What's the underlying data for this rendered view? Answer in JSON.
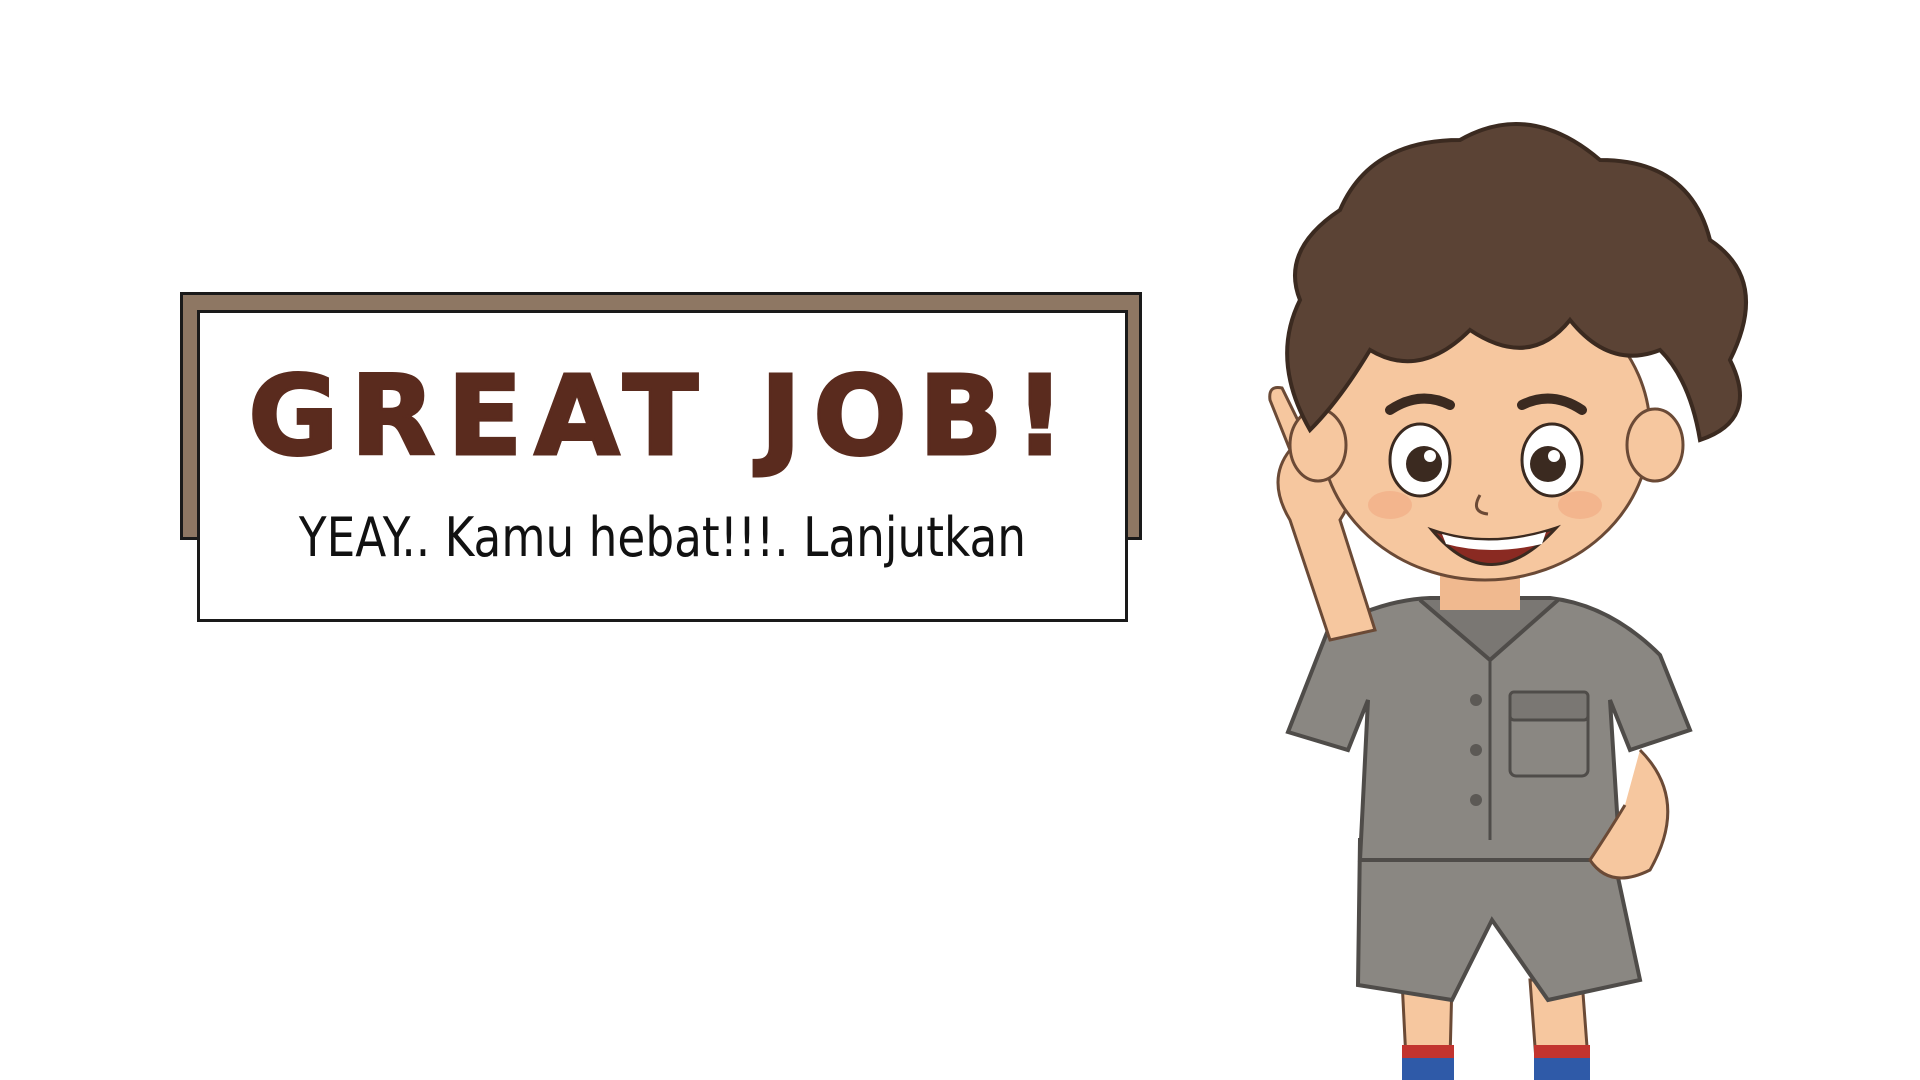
{
  "banner": {
    "title": "GREAT JOB!",
    "subtitle": "YEAY.. Kamu hebat!!!. Lanjutkan"
  },
  "illustration": {
    "subject": "boy-explorer-pointing-up"
  },
  "colors": {
    "title": "#5a2b1e",
    "banner_shadow": "#8e7763",
    "hair": "#5b4335",
    "skin": "#f6c79f",
    "uniform": "#8a8782",
    "sock_red": "#c2342f",
    "sock_blue": "#2f5aa8"
  }
}
